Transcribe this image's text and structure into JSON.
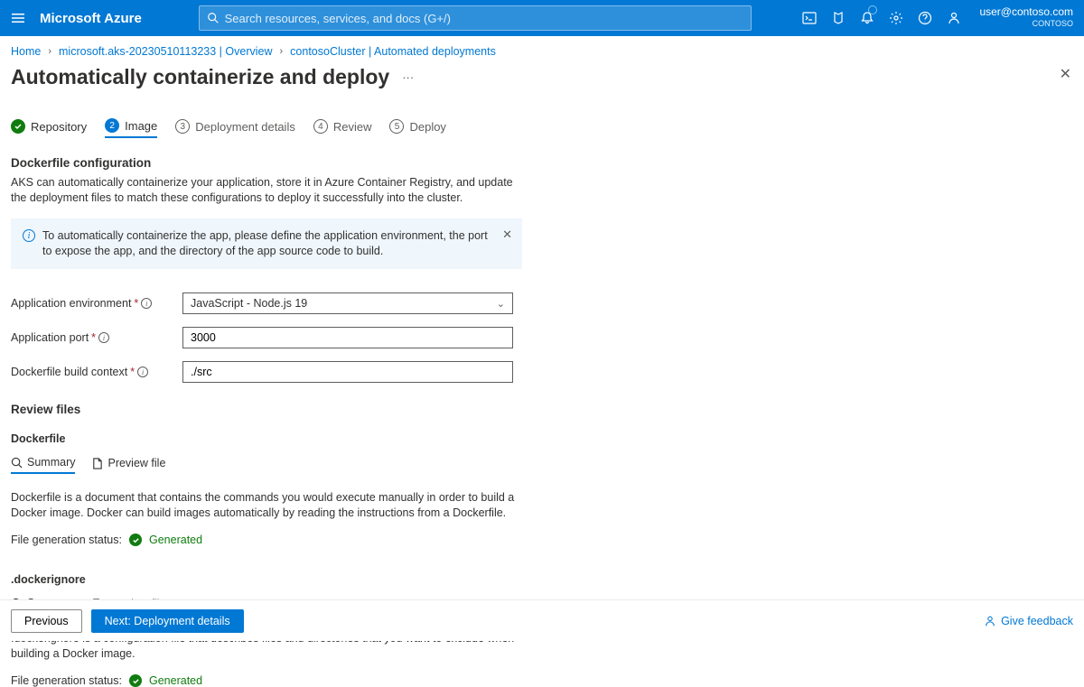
{
  "header": {
    "brand": "Microsoft Azure",
    "search_placeholder": "Search resources, services, and docs (G+/)",
    "user_email": "user@contoso.com",
    "user_org": "CONTOSO"
  },
  "breadcrumb": [
    "Home",
    "microsoft.aks-20230510113233 | Overview",
    "contosoCluster | Automated deployments"
  ],
  "page": {
    "title": "Automatically containerize and deploy"
  },
  "steps": [
    {
      "label": "Repository",
      "state": "done"
    },
    {
      "label": "Image",
      "state": "current",
      "num": "2"
    },
    {
      "label": "Deployment details",
      "state": "pending",
      "num": "3"
    },
    {
      "label": "Review",
      "state": "pending",
      "num": "4"
    },
    {
      "label": "Deploy",
      "state": "pending",
      "num": "5"
    }
  ],
  "dockerfile_config": {
    "heading": "Dockerfile configuration",
    "desc": "AKS can automatically containerize your application, store it in Azure Container Registry, and update the deployment files to match these configurations to deploy it successfully into the cluster.",
    "info": "To automatically containerize the app, please define the application environment, the port to expose the app, and the directory of the app source code to build."
  },
  "form": {
    "env_label": "Application environment",
    "env_value": "JavaScript - Node.js 19",
    "port_label": "Application port",
    "port_value": "3000",
    "ctx_label": "Dockerfile build context",
    "ctx_value": "./src"
  },
  "review": {
    "heading": "Review files",
    "tabs": {
      "summary": "Summary",
      "preview": "Preview file"
    },
    "dockerfile": {
      "title": "Dockerfile",
      "desc": "Dockerfile is a document that contains the commands you would execute manually in order to build a Docker image. Docker can build images automatically by reading the instructions from a Dockerfile.",
      "status_label": "File generation status:",
      "status_value": "Generated"
    },
    "dockerignore": {
      "title": ".dockerignore",
      "desc": ".dockerignore is a configuration file that describes files and directories that you want to exclude when building a Docker image.",
      "status_label": "File generation status:",
      "status_value": "Generated"
    }
  },
  "footer": {
    "previous": "Previous",
    "next": "Next: Deployment details",
    "feedback": "Give feedback"
  }
}
